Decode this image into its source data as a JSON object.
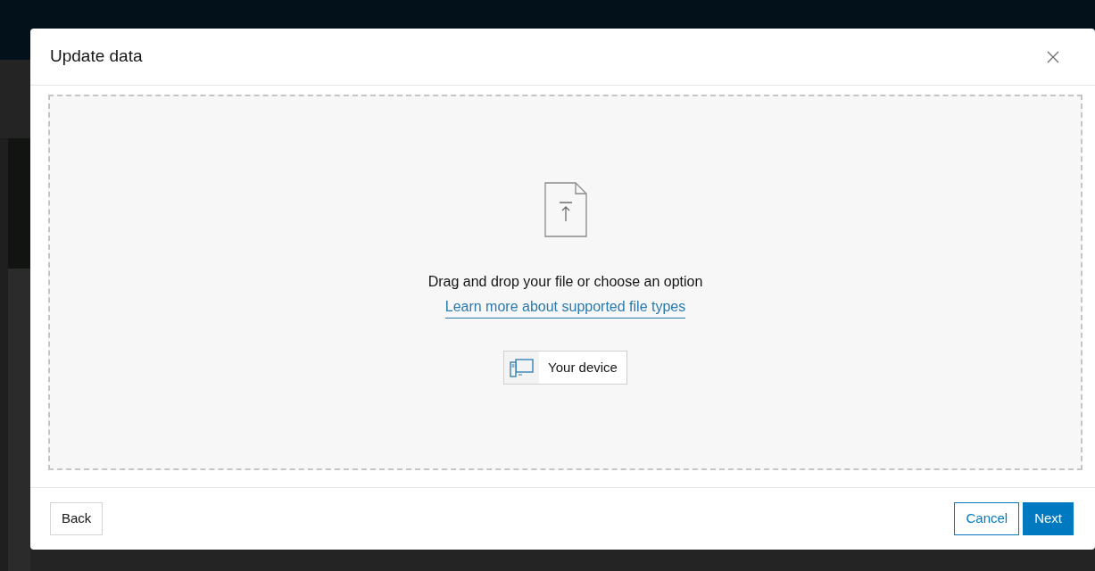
{
  "dialog": {
    "title": "Update data",
    "dropzone": {
      "heading": "Drag and drop your file or choose an option",
      "link": "Learn more about supported file types",
      "options": [
        {
          "label": "Your device"
        }
      ]
    },
    "footer": {
      "left": [
        {
          "label": "Back",
          "kind": "outline-neutral"
        }
      ],
      "right": [
        {
          "label": "Cancel",
          "kind": "outline"
        },
        {
          "label": "Next",
          "kind": "primary"
        }
      ]
    }
  }
}
